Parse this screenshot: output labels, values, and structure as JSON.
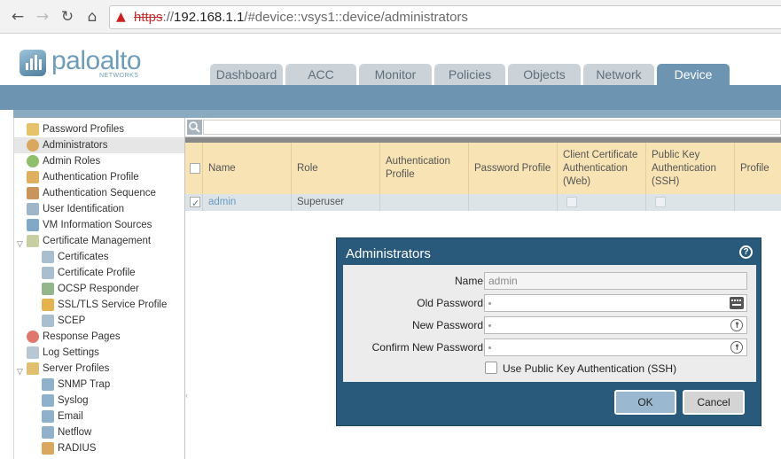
{
  "browser": {
    "back": "←",
    "forward": "→",
    "reload": "↻",
    "home": "⌂",
    "url_scheme": "https",
    "url_separator": "://",
    "url_host": "192.168.1.1",
    "url_path": "/#device::vsys1::device/administrators"
  },
  "header": {
    "logo_text": "paloalto",
    "logo_sub": "NETWORKS",
    "tabs": [
      {
        "label": "Dashboard"
      },
      {
        "label": "ACC"
      },
      {
        "label": "Monitor"
      },
      {
        "label": "Policies"
      },
      {
        "label": "Objects"
      },
      {
        "label": "Network"
      },
      {
        "label": "Device"
      }
    ],
    "active_tab": "Device"
  },
  "sidebar": {
    "items": [
      {
        "label": "Password Profiles",
        "icon": "password-profile-icon"
      },
      {
        "label": "Administrators",
        "icon": "administrator-icon",
        "selected": true
      },
      {
        "label": "Admin Roles",
        "icon": "admin-role-icon"
      },
      {
        "label": "Authentication Profile",
        "icon": "auth-profile-icon"
      },
      {
        "label": "Authentication Sequence",
        "icon": "auth-sequence-icon"
      },
      {
        "label": "User Identification",
        "icon": "user-id-icon"
      },
      {
        "label": "VM Information Sources",
        "icon": "vm-info-icon"
      },
      {
        "label": "Certificate Management",
        "icon": "cert-management-icon",
        "expanded": true
      },
      {
        "label": "Certificates",
        "icon": "certificate-icon"
      },
      {
        "label": "Certificate Profile",
        "icon": "cert-profile-icon"
      },
      {
        "label": "OCSP Responder",
        "icon": "ocsp-icon"
      },
      {
        "label": "SSL/TLS Service Profile",
        "icon": "lock-icon"
      },
      {
        "label": "SCEP",
        "icon": "scep-icon"
      },
      {
        "label": "Response Pages",
        "icon": "response-pages-icon"
      },
      {
        "label": "Log Settings",
        "icon": "log-settings-icon"
      },
      {
        "label": "Server Profiles",
        "icon": "server-profiles-icon",
        "expanded": true
      },
      {
        "label": "SNMP Trap",
        "icon": "snmp-icon"
      },
      {
        "label": "Syslog",
        "icon": "syslog-icon"
      },
      {
        "label": "Email",
        "icon": "email-icon"
      },
      {
        "label": "Netflow",
        "icon": "netflow-icon"
      },
      {
        "label": "RADIUS",
        "icon": "radius-icon"
      }
    ]
  },
  "grid": {
    "search_icon": "🔍",
    "columns": [
      {
        "label": "Name"
      },
      {
        "label": "Role"
      },
      {
        "label": "Authentication Profile"
      },
      {
        "label": "Password Profile"
      },
      {
        "label": "Client Certificate Authentication (Web)"
      },
      {
        "label": "Public Key Authentication (SSH)"
      },
      {
        "label": "Profile"
      }
    ],
    "rows": [
      {
        "name": "admin",
        "role": "Superuser",
        "auth_profile": "",
        "password_profile": "",
        "checked": true
      }
    ]
  },
  "dialog": {
    "title": "Administrators",
    "help": "?",
    "fields": {
      "name_label": "Name",
      "name_value": "admin",
      "old_password_label": "Old Password",
      "new_password_label": "New Password",
      "confirm_password_label": "Confirm New Password"
    },
    "ssh_label": "Use Public Key Authentication (SSH)",
    "ssh_checked": false,
    "ok_label": "OK",
    "cancel_label": "Cancel"
  },
  "colors": {
    "header_band": "#6d95b2",
    "grid_header": "#f7e3b3",
    "dialog_bg": "#295a7c",
    "warning_red": "#cc2222"
  }
}
